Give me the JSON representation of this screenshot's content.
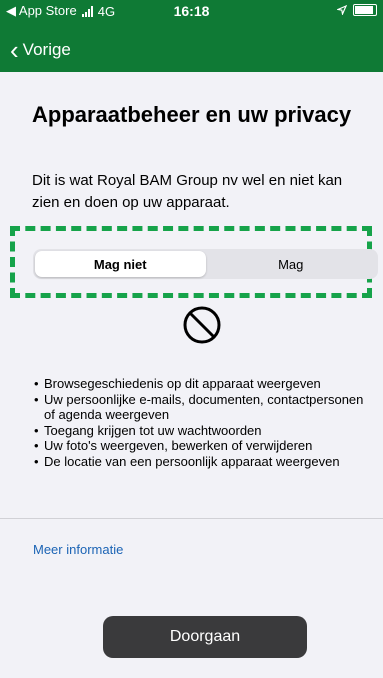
{
  "statusbar": {
    "carrier": "◀ App Store",
    "network": "4G",
    "time": "16:18"
  },
  "nav": {
    "back_label": "Vorige"
  },
  "page": {
    "title": "Apparaatbeheer en uw privacy",
    "description": "Dit is wat Royal BAM Group nv wel en niet kan zien en doen op uw apparaat."
  },
  "segment": {
    "options": [
      "Mag niet",
      "Mag"
    ],
    "selected": "Mag niet"
  },
  "list": {
    "items": [
      "Browsegeschiedenis op dit apparaat weergeven",
      "Uw persoonlijke e-mails, documenten, contactpersonen of agenda weergeven",
      "Toegang krijgen tot uw wachtwoorden",
      "Uw foto's weergeven, bewerken of verwijderen",
      "De locatie van een persoonlijk apparaat weergeven"
    ]
  },
  "links": {
    "more_info": "Meer informatie"
  },
  "footer": {
    "continue_label": "Doorgaan"
  },
  "colors": {
    "header": "#0f7a35",
    "highlight": "#16a34a",
    "link": "#1c64b5",
    "button": "#3a3a3c"
  },
  "icons": {
    "block": "prohibited-icon",
    "location": "location-arrow-icon"
  }
}
